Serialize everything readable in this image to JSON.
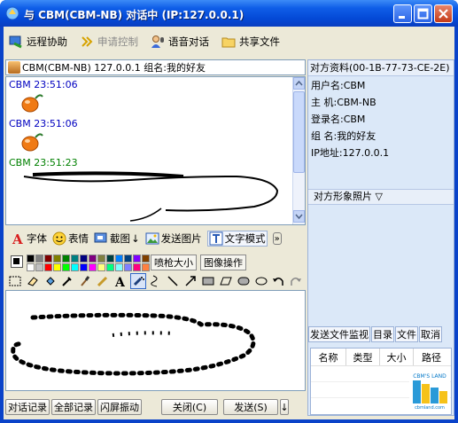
{
  "window": {
    "title": "与 CBM(CBM-NB) 对话中 (IP:127.0.0.1)"
  },
  "toolbar": {
    "items": [
      {
        "label": "远程协助",
        "icon": "remote-assist-icon",
        "enabled": true
      },
      {
        "label": "申请控制",
        "icon": "request-control-icon",
        "enabled": false
      },
      {
        "label": "语音对话",
        "icon": "voice-chat-icon",
        "enabled": true
      },
      {
        "label": "共享文件",
        "icon": "shared-folder-icon",
        "enabled": true
      }
    ]
  },
  "peer": {
    "label": "CBM(CBM-NB) 127.0.0.1 组名:我的好友"
  },
  "chat": {
    "messages": [
      {
        "sender_time": "CBM 23:51:06",
        "color": "#0000c0",
        "content": "emoticon-face"
      },
      {
        "sender_time": "CBM 23:51:06",
        "color": "#0000c0",
        "content": "emoticon-face"
      },
      {
        "sender_time": "CBM 23:51:23",
        "color": "#008000",
        "content": "drawing"
      }
    ]
  },
  "format_bar": {
    "font": "字体",
    "emoji": "表情",
    "screenshot": "截图",
    "send_image": "发送图片",
    "text_mode": "文字模式",
    "more": "»"
  },
  "paint": {
    "spray_size": "喷枪大小",
    "image_ops": "图像操作",
    "colors": [
      "#000000",
      "#808080",
      "#800000",
      "#808000",
      "#008000",
      "#008080",
      "#000080",
      "#800080",
      "#808040",
      "#004040",
      "#0080ff",
      "#004080",
      "#8000ff",
      "#804000",
      "#ffffff",
      "#c0c0c0",
      "#ff0000",
      "#ffff00",
      "#00ff00",
      "#00ffff",
      "#0000ff",
      "#ff00ff",
      "#ffff80",
      "#00ff80",
      "#80ffff",
      "#8080ff",
      "#ff0080",
      "#ff8040"
    ]
  },
  "bottom": {
    "history": "对话记录",
    "all_history": "全部记录",
    "shake": "闪屏振动",
    "close": "关闭(C)",
    "send": "发送(S)",
    "send_menu": "↓"
  },
  "peer_info": {
    "header": "对方资料(00-1B-77-73-CE-2E)",
    "username": "用户名:CBM",
    "host": "主  机:CBM-NB",
    "login": "登录名:CBM",
    "group": "组  名:我的好友",
    "ip": "IP地址:127.0.0.1",
    "photo_header": "对方形象照片 ▽"
  },
  "file_transfer": {
    "tabs": [
      "发送文件监视",
      "目录",
      "文件",
      "取消"
    ],
    "columns": [
      "名称",
      "类型",
      "大小",
      "路径"
    ]
  },
  "logo": {
    "text_top": "CBM'S LAND",
    "text_bottom": "cbmland.com"
  }
}
